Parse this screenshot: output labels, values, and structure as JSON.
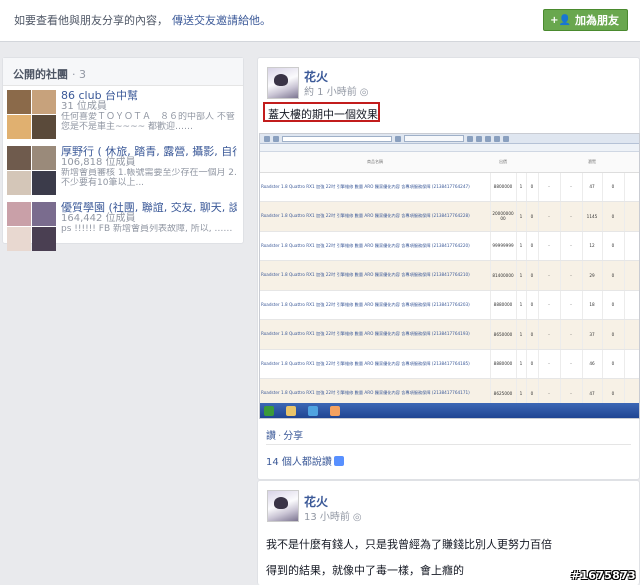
{
  "topbar": {
    "message": "如要查看他與朋友分享的內容，",
    "invite_link": "傳送交友邀請給他。",
    "add_friend_label": "加為朋友",
    "add_friend_icon": "add-friend-icon"
  },
  "groups": {
    "title": "公開的社團",
    "count": "· 3",
    "items": [
      {
        "name": "86 club 台中幫",
        "members": "31 位成員",
        "desc": "任何喜愛ＴＯＹＯＴＡ　８６的中部人 不管您是不是車主~~~~ 都歡迎……",
        "thumbs": [
          "#8b6a4a",
          "#c7a27c",
          "#e0b070",
          "#5a4a3a"
        ]
      },
      {
        "name": "厚野行 ( 休旅, 踏青, 露營, 攝影, 自行車…",
        "members": "106,818 位成員",
        "desc": "新增會員審核 1.帳號需要至少存在一個月 2.不少要有10筆以上...",
        "thumbs": [
          "#6f5b4d",
          "#9a8a7a",
          "#d4c6b8",
          "#3b3b4a"
        ]
      },
      {
        "name": "優質學園 (社團, 聯誼, 交友, 聊天, 談心…)",
        "members": "164,442 位成員",
        "desc": "ps !!!!!! FB 新增會員列表故障, 所以, ……",
        "thumbs": [
          "#c9a0a8",
          "#7a6c8e",
          "#e8d8d0",
          "#4a3f52"
        ]
      }
    ]
  },
  "post1": {
    "author": "花火",
    "time": "約 1 小時前",
    "caption": "蓋大樓的期中一個效果",
    "screenshot_rows": [
      {
        "title": "Roadster 1.8 Quattro RX1 加強 22吋 引擎維修 數量 ARO 獨家優化內容 含專項服務保障 (2138417764247)",
        "id": "8800000",
        "n1": "1",
        "n2": "0",
        "c1": "-",
        "c2": "-",
        "v": "47",
        "o": "0"
      },
      {
        "title": "Roadster 1.8 Quattro RX1 加強 22吋 引擎維修 數量 ARO 獨家優化內容 含專項服務保障 (2138417764228)",
        "id": "20000000 00",
        "n1": "1",
        "n2": "0",
        "c1": "-",
        "c2": "-",
        "v": "1145",
        "o": "0"
      },
      {
        "title": "Roadster 1.8 Quattro RX1 加強 22吋 引擎維修 數量 ARO 獨家優化內容 含專項服務保障 (2138417764220)",
        "id": "99999999",
        "n1": "1",
        "n2": "0",
        "c1": "-",
        "c2": "-",
        "v": "12",
        "o": "0"
      },
      {
        "title": "Roadster 1.8 Quattro RX1 加強 22吋 引擎維修 數量 ARO 獨家優化內容 含專項服務保障 (2138417764210)",
        "id": "81400000",
        "n1": "1",
        "n2": "0",
        "c1": "-",
        "c2": "-",
        "v": "29",
        "o": "0"
      },
      {
        "title": "Roadster 1.8 Quattro RX1 加強 22吋 引擎維修 數量 ARO 獨家優化內容 含專項服務保障 (2138417764203)",
        "id": "8880000",
        "n1": "1",
        "n2": "0",
        "c1": "-",
        "c2": "-",
        "v": "18",
        "o": "0"
      },
      {
        "title": "Roadster 1.8 Quattro RX1 加強 22吋 引擎維修 數量 ARO 獨家優化內容 含專項服務保障 (2138417764193)",
        "id": "8650000",
        "n1": "1",
        "n2": "0",
        "c1": "-",
        "c2": "-",
        "v": "37",
        "o": "0"
      },
      {
        "title": "Roadster 1.8 Quattro RX1 加強 22吋 引擎維修 數量 ARO 獨家優化內容 含專項服務保障 (2138417764185)",
        "id": "8880000",
        "n1": "1",
        "n2": "0",
        "c1": "-",
        "c2": "-",
        "v": "46",
        "o": "0"
      },
      {
        "title": "Roadster 1.8 Quattro RX1 加強 22吋 引擎維修 數量 ARO 獨家優化內容 含專項服務保障 (2138417764171)",
        "id": "8625000",
        "n1": "1",
        "n2": "0",
        "c1": "-",
        "c2": "-",
        "v": "47",
        "o": "0"
      },
      {
        "title": "Roadster 1.8 Quattro RX1 加強 22吋 引擎維修 數量 ARO 獨家優化內容 含專項服務保障 (2138127237805)",
        "id": "8870000",
        "n1": "1",
        "n2": "0",
        "c1": "-",
        "c2": "-",
        "v": "3235",
        "o": "0"
      }
    ],
    "action_like": "讚",
    "action_share": "分享",
    "likes_text": "14 個人都說讚"
  },
  "post2": {
    "author": "花火",
    "time": "13 小時前",
    "line1": "我不是什麼有錢人，只是我曾經為了賺錢比別人更努力百倍",
    "line2": "得到的結果，就像中了毒一樣，會上癮的"
  },
  "watermark": "#1675873",
  "colors": {
    "link": "#3b5998",
    "button_green": "#69a74e",
    "highlight_red": "#c21c1c"
  }
}
